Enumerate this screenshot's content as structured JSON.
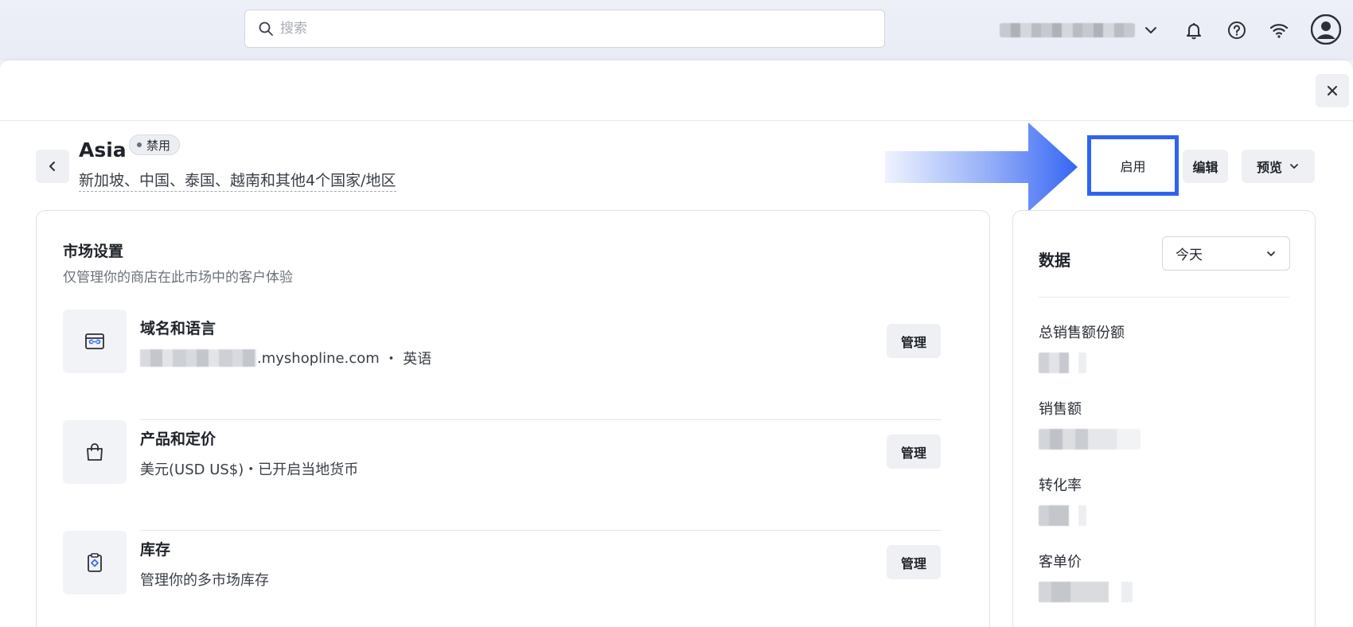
{
  "header": {
    "search_placeholder": "搜索",
    "icons": [
      "search-icon",
      "chevron-down-icon",
      "bell-icon",
      "help-icon",
      "wifi-icon",
      "user-avatar-icon"
    ]
  },
  "market": {
    "name": "Asia",
    "status": "禁用",
    "regions": "新加坡、中国、泰国、越南和其他4个国家/地区"
  },
  "actions": {
    "enable": "启用",
    "edit": "编辑",
    "preview": "预览"
  },
  "settings": {
    "title": "市场设置",
    "subtitle": "仅管理你的商店在此市场中的客户体验",
    "manage_label": "管理",
    "rows": [
      {
        "name": "域名和语言",
        "domain_suffix": ".myshopline.com",
        "language": "英语",
        "icon": "domain-link-icon"
      },
      {
        "name": "产品和定价",
        "desc": "美元(USD US$)・已开启当地货币",
        "icon": "shopping-bag-icon"
      },
      {
        "name": "库存",
        "desc": "管理你的多市场库存",
        "icon": "clipboard-inventory-icon"
      }
    ]
  },
  "data": {
    "title": "数据",
    "period": "今天",
    "metrics": [
      {
        "label": "总销售额份额"
      },
      {
        "label": "销售额"
      },
      {
        "label": "转化率"
      },
      {
        "label": "客单价"
      }
    ]
  },
  "colors": {
    "accent_blue": "#2f64f0",
    "button_gray": "#eef0f4"
  }
}
